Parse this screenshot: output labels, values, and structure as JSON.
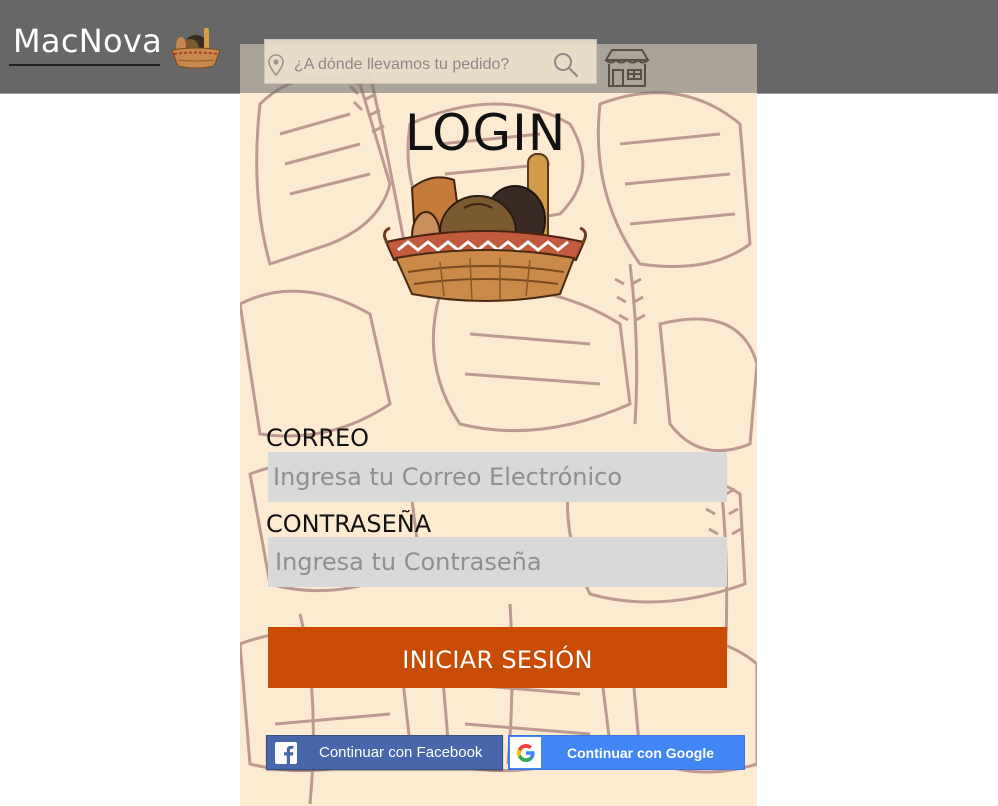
{
  "header": {
    "brand": "MacNova",
    "brand_logo_icon": "bread-basket-icon",
    "search": {
      "placeholder": "¿A dónde llevamos tu pedido?",
      "pin_icon": "location-pin-icon",
      "button_icon": "search-icon"
    },
    "store_icon": "store-icon"
  },
  "login": {
    "title": "LOGIN",
    "illustration": "bread-basket-icon",
    "email_label": "CORREO",
    "email_placeholder": "Ingresa tu Correo Electrónico",
    "password_label": "CONTRASEÑA",
    "password_placeholder": "Ingresa tu Contraseña",
    "submit_label": "INICIAR SESIÓN",
    "facebook_label": "Continuar con Facebook",
    "google_label": "Continuar con Google"
  },
  "colors": {
    "header_bg": "#676767",
    "panel_bg": "#fdebd1",
    "pattern": "#b48b86",
    "primary_button": "#c94c04",
    "facebook": "#4867aa",
    "google": "#4285f4",
    "input_bg": "#d9d9d9"
  }
}
